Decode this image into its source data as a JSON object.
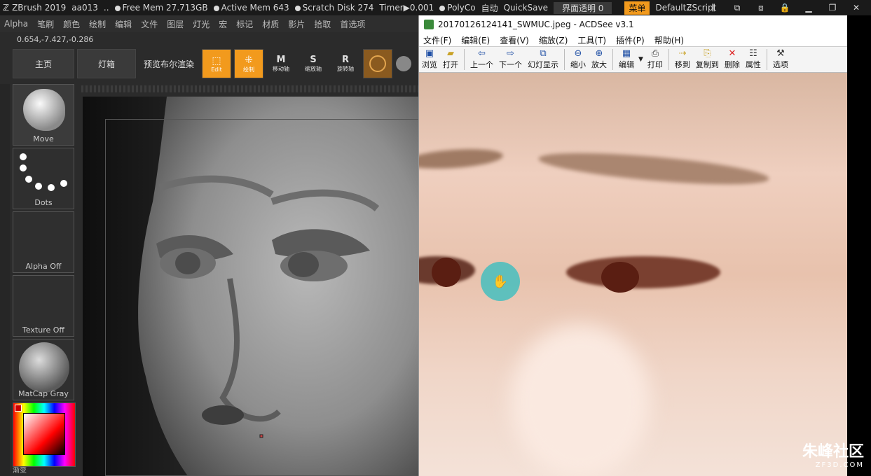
{
  "zbrush": {
    "title_bar": {
      "app_name": "ZBrush 2019",
      "project": "aa013",
      "ellipsis": "..",
      "free_mem": "Free Mem 27.713GB",
      "active_mem": "Active Mem 643",
      "scratch_disk": "Scratch Disk 274",
      "timer": "Timer▶0.001",
      "polycount": "PolyCo",
      "auto": "自动",
      "quicksave": "QuickSave",
      "transparency": "界面透明 0",
      "menu_btn": "菜单",
      "script": "DefaultZScript"
    },
    "menu": [
      "Alpha",
      "笔刷",
      "颜色",
      "绘制",
      "编辑",
      "文件",
      "图层",
      "灯光",
      "宏",
      "标记",
      "材质",
      "影片",
      "拾取",
      "首选项"
    ],
    "coords": "0.654,-7.427,-0.286",
    "toolbar": {
      "home": "主页",
      "lightbox": "灯箱",
      "bpr": "预览布尔渲染",
      "edit": "Edit",
      "draw": "绘制",
      "move": "移动轴",
      "scale": "缩放轴",
      "rotate": "旋转轴"
    },
    "shelf": [
      {
        "label": "Move"
      },
      {
        "label": "Dots"
      },
      {
        "label": "Alpha Off"
      },
      {
        "label": "Texture Off"
      },
      {
        "label": "MatCap Gray"
      }
    ],
    "gradient_label": "渐变"
  },
  "acdsee": {
    "title": "20170126124141_SWMUC.jpeg - ACDSee v3.1",
    "menu": [
      "文件(F)",
      "编辑(E)",
      "查看(V)",
      "缩放(Z)",
      "工具(T)",
      "插件(P)",
      "帮助(H)"
    ],
    "toolbar": [
      {
        "label": "浏览",
        "icon": "browse-icon"
      },
      {
        "label": "打开",
        "icon": "open-icon"
      },
      {
        "label": "上一个",
        "icon": "prev-icon"
      },
      {
        "label": "下一个",
        "icon": "next-icon"
      },
      {
        "label": "幻灯显示",
        "icon": "slideshow-icon"
      },
      {
        "label": "缩小",
        "icon": "zoom-out-icon"
      },
      {
        "label": "放大",
        "icon": "zoom-in-icon"
      },
      {
        "label": "编辑",
        "icon": "edit-icon"
      },
      {
        "label": "打印",
        "icon": "print-icon"
      },
      {
        "label": "移到",
        "icon": "move-to-icon"
      },
      {
        "label": "复制到",
        "icon": "copy-to-icon"
      },
      {
        "label": "删除",
        "icon": "delete-icon"
      },
      {
        "label": "属性",
        "icon": "properties-icon"
      },
      {
        "label": "选项",
        "icon": "options-icon"
      }
    ]
  },
  "watermark": {
    "text": "朱峰社区",
    "url": "ZF3D.COM"
  }
}
